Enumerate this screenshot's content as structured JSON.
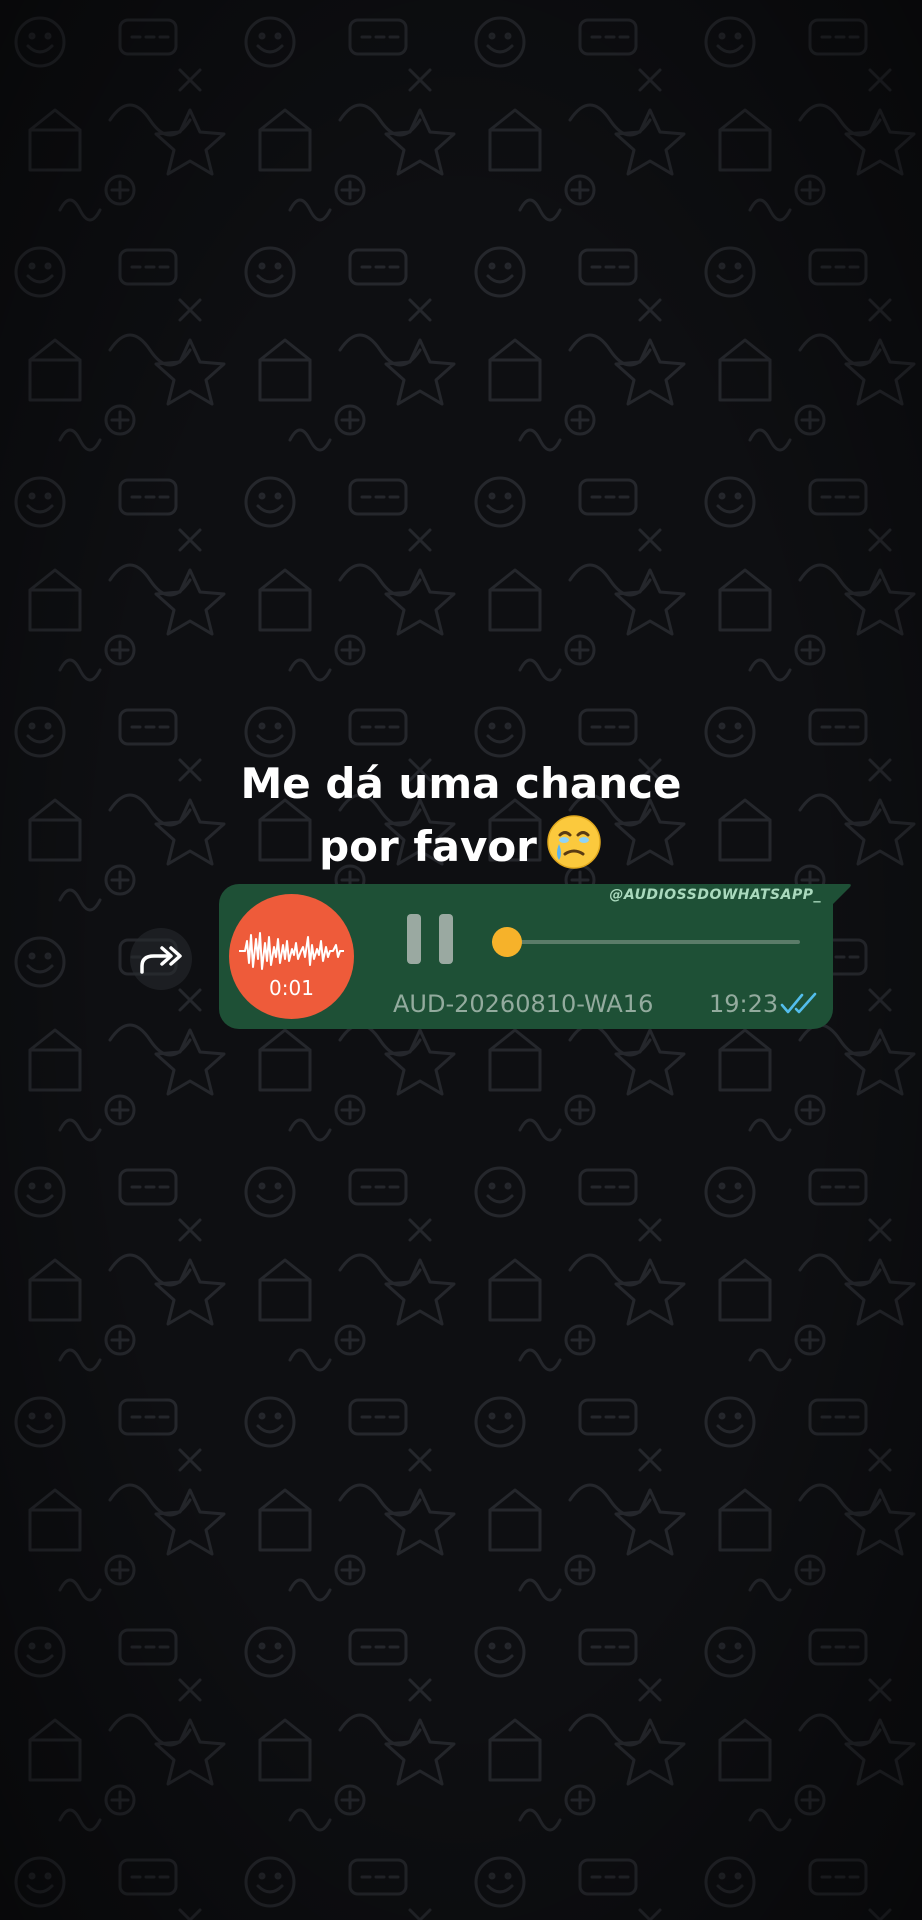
{
  "caption": {
    "line1": "Me dá uma chance",
    "line2": "por favor",
    "emoji": "face-holding-back-tears"
  },
  "message": {
    "type": "voice-note",
    "watermark": "@AUDIOSSDOWHATSAPP_",
    "duration": "0:01",
    "filename": "AUD-20260810-WA169…",
    "time": "19:23",
    "status": "read",
    "progress": 0.05,
    "playing": true
  },
  "icons": {
    "forward": "forward-icon",
    "pause": "pause-icon",
    "waveform": "waveform-icon",
    "ticks": "double-check-icon"
  },
  "colors": {
    "background": "#0e0f12",
    "bubble": "#1e5036",
    "avatar": "#ee5b3a",
    "seek_thumb": "#f6b22a",
    "ticks": "#53bdeb",
    "meta_text": "#93ab9e"
  }
}
